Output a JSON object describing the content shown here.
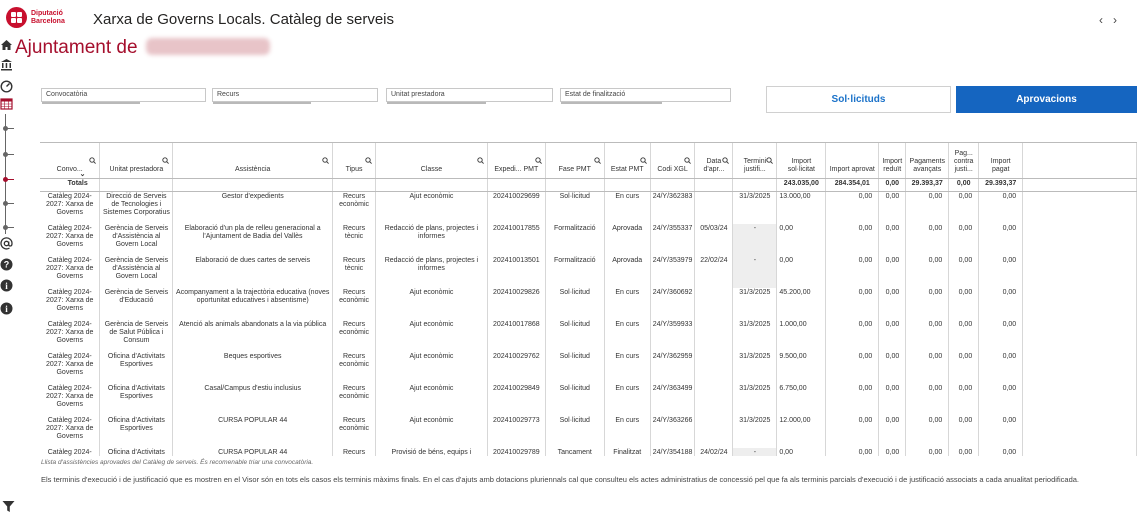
{
  "header": {
    "logo_line1": "Diputació",
    "logo_line2": "Barcelona",
    "title": "Xarxa de Governs Locals. Catàleg de serveis",
    "nav_prev": "‹",
    "nav_next": "›"
  },
  "page": {
    "title_prefix": "Ajuntament de"
  },
  "rail": {
    "icons": [
      "home-icon",
      "building-icon",
      "gauge-icon",
      "calendar-icon",
      "at-icon",
      "question-icon",
      "info-icon",
      "info-icon"
    ]
  },
  "filters": {
    "convocatoria": "Convocatòria",
    "recurs": "Recurs",
    "unitat": "Unitat prestadora",
    "estat": "Estat de finalització"
  },
  "tabs": {
    "sollicituds": "Sol·licituds",
    "aprovacions": "Aprovacions"
  },
  "table": {
    "columns": [
      {
        "label": "Convo...",
        "search": true
      },
      {
        "label": "Unitat prestadora",
        "search": true
      },
      {
        "label": "Assistència",
        "search": true
      },
      {
        "label": "Tipus",
        "search": true
      },
      {
        "label": "Classe",
        "search": true
      },
      {
        "label": "Expedi... PMT",
        "search": true
      },
      {
        "label": "Fase PMT",
        "search": true
      },
      {
        "label": "Estat PMT",
        "search": true
      },
      {
        "label": "Codi XGL",
        "search": true
      },
      {
        "label": "Data d'apr...",
        "search": true
      },
      {
        "label": "Termini justifi...",
        "search": true
      },
      {
        "label": "Import sol·licitat",
        "search": false
      },
      {
        "label": "Import aprovat",
        "search": false
      },
      {
        "label": "Import reduït",
        "search": false
      },
      {
        "label": "Pagaments avançats",
        "search": false
      },
      {
        "label": "Pag... contra justi...",
        "search": false
      },
      {
        "label": "Import pagat",
        "search": false
      }
    ],
    "sort_indicator": "⌄",
    "search_icon": "🔍",
    "totals": {
      "label": "Totals",
      "import_sollicitat": "243.035,00",
      "import_aprovat": "284.354,01",
      "import_reduit": "0,00",
      "pagaments_avancats": "29.393,37",
      "pag_contra_justi": "0,00",
      "import_pagat": "29.393,37"
    },
    "rows": [
      [
        "Catàleg 2024-2027: Xarxa de Governs",
        "Direcció de Serveis de Tecnologies i Sistemes Corporatius",
        "Gestor d'expedients",
        "Recurs econòmic",
        "Ajut econòmic",
        "202410029699",
        "Sol·licitud",
        "En curs",
        "24/Y/362383",
        "",
        "31/3/2025",
        "13.000,00",
        "0,00",
        "0,00",
        "0,00",
        "0,00",
        "0,00"
      ],
      [
        "Catàleg 2024-2027: Xarxa de Governs",
        "Gerència de Serveis d'Assistència al Govern Local",
        "Elaboració d'un pla de relleu generacional a l'Ajuntament de Badia del Vallès",
        "Recurs tècnic",
        "Redacció de plans, projectes i informes",
        "202410017855",
        "Formalització",
        "Aprovada",
        "24/Y/355337",
        "05/03/24",
        "-",
        "0,00",
        "0,00",
        "0,00",
        "0,00",
        "0,00",
        "0,00"
      ],
      [
        "Catàleg 2024-2027: Xarxa de Governs",
        "Gerència de Serveis d'Assistència al Govern Local",
        "Elaboració de dues cartes de serveis",
        "Recurs tècnic",
        "Redacció de plans, projectes i informes",
        "202410013501",
        "Formalització",
        "Aprovada",
        "24/Y/353979",
        "22/02/24",
        "-",
        "0,00",
        "0,00",
        "0,00",
        "0,00",
        "0,00",
        "0,00"
      ],
      [
        "Catàleg 2024-2027: Xarxa de Governs",
        "Gerència de Serveis d'Educació",
        "Acompanyament a la trajectòria educativa (noves oportunitat educatives i absentisme)",
        "Recurs econòmic",
        "Ajut econòmic",
        "202410029826",
        "Sol·licitud",
        "En curs",
        "24/Y/360692",
        "",
        "31/3/2025",
        "45.200,00",
        "0,00",
        "0,00",
        "0,00",
        "0,00",
        "0,00"
      ],
      [
        "Catàleg 2024-2027: Xarxa de Governs",
        "Gerència de Serveis de Salut Pública i Consum",
        "Atenció als animals abandonats a la via pública",
        "Recurs econòmic",
        "Ajut econòmic",
        "202410017868",
        "Sol·licitud",
        "En curs",
        "24/Y/359933",
        "",
        "31/3/2025",
        "1.000,00",
        "0,00",
        "0,00",
        "0,00",
        "0,00",
        "0,00"
      ],
      [
        "Catàleg 2024-2027: Xarxa de Governs",
        "Oficina d'Activitats Esportives",
        "Beques esportives",
        "Recurs econòmic",
        "Ajut econòmic",
        "202410029762",
        "Sol·licitud",
        "En curs",
        "24/Y/362959",
        "",
        "31/3/2025",
        "9.500,00",
        "0,00",
        "0,00",
        "0,00",
        "0,00",
        "0,00"
      ],
      [
        "Catàleg 2024-2027: Xarxa de Governs",
        "Oficina d'Activitats Esportives",
        "Casal/Campus d'estiu inclusius",
        "Recurs econòmic",
        "Ajut econòmic",
        "202410029849",
        "Sol·licitud",
        "En curs",
        "24/Y/363499",
        "",
        "31/3/2025",
        "6.750,00",
        "0,00",
        "0,00",
        "0,00",
        "0,00",
        "0,00"
      ],
      [
        "Catàleg 2024-2027: Xarxa de Governs",
        "Oficina d'Activitats Esportives",
        "CURSA POPULAR 44",
        "Recurs econòmic",
        "Ajut econòmic",
        "202410029773",
        "Sol·licitud",
        "En curs",
        "24/Y/363266",
        "",
        "31/3/2025",
        "12.000,00",
        "0,00",
        "0,00",
        "0,00",
        "0,00",
        "0,00"
      ],
      [
        "Catàleg 2024-",
        "Oficina d'Activitats",
        "CURSA POPULAR 44",
        "Recurs",
        "Provisió de béns, equips i",
        "202410029789",
        "Tancament",
        "Finalitzat",
        "24/Y/354188",
        "24/02/24",
        "-",
        "0,00",
        "0,00",
        "0,00",
        "0,00",
        "0,00",
        "0,00"
      ]
    ]
  },
  "footnote": "Llista d'assistències aprovades del Catàleg de serveis. És recomenable triar una convocatòria.",
  "note": "Els terminis d'execució i de justificació que es mostren en el Visor són en tots els casos els terminis màxims finals. En el cas d'ajuts amb dotacions pluriennals cal que consulteu els actes administratius de concessió pel que fa als terminis parcials d'execució i de justificació associats a cada anualitat periodificada.",
  "colors": {
    "brand_red": "#c8102e",
    "title_red": "#a50f2d",
    "active_tab": "#1565c0",
    "inactive_tab_text": "#1b72c9"
  }
}
